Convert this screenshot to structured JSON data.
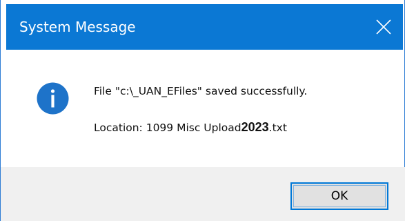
{
  "window": {
    "title": "System Message",
    "close_icon": "close-icon",
    "accent_color": "#0b78d4"
  },
  "message": {
    "icon": "info-icon",
    "line1": "File \"c:\\_UAN_EFiles\" saved successfully.",
    "line2_prefix": "Location: 1099 Misc Upload",
    "line2_bold": "2023",
    "line2_suffix": ".txt"
  },
  "buttons": {
    "ok_label": "OK"
  }
}
